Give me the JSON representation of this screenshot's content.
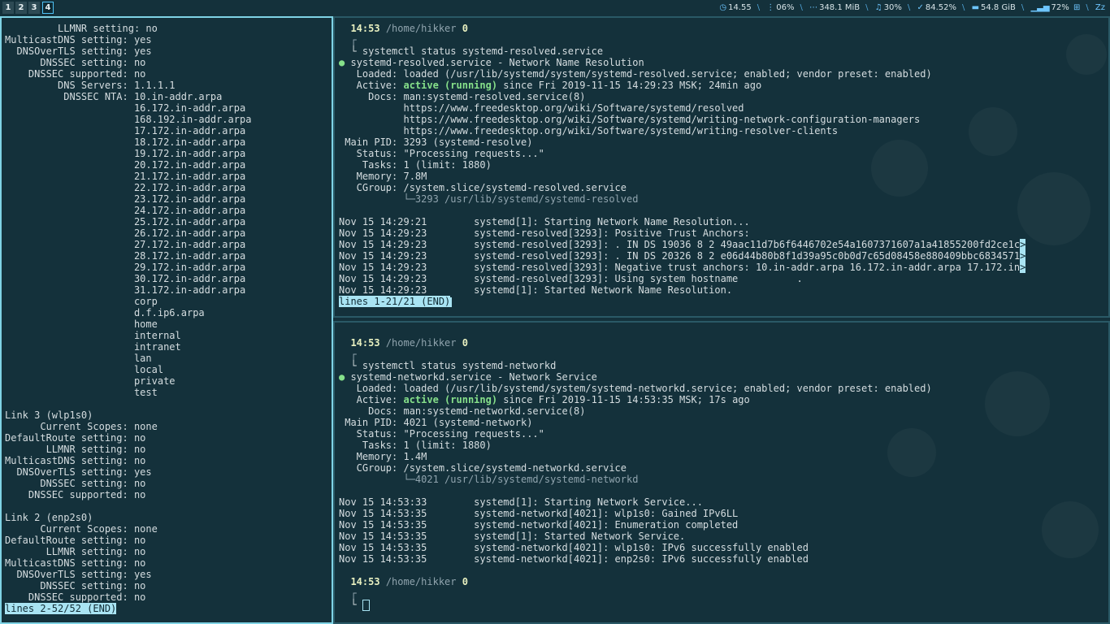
{
  "workspaces": [
    "1",
    "2",
    "3",
    "4"
  ],
  "active_workspace": "4",
  "status": {
    "clock": "14.55",
    "cpu": "06%",
    "memory": "348.1 MiB",
    "volume": "30%",
    "battery": "84.52%",
    "disk": "54.8 GiB",
    "wifi": "72%",
    "zz": "Zz"
  },
  "left": {
    "lines": [
      "         LLMNR setting: no",
      "MulticastDNS setting: yes",
      "  DNSOverTLS setting: yes",
      "      DNSSEC setting: no",
      "    DNSSEC supported: no",
      "         DNS Servers: 1.1.1.1",
      "          DNSSEC NTA: 10.in-addr.arpa",
      "                      16.172.in-addr.arpa",
      "                      168.192.in-addr.arpa",
      "                      17.172.in-addr.arpa",
      "                      18.172.in-addr.arpa",
      "                      19.172.in-addr.arpa",
      "                      20.172.in-addr.arpa",
      "                      21.172.in-addr.arpa",
      "                      22.172.in-addr.arpa",
      "                      23.172.in-addr.arpa",
      "                      24.172.in-addr.arpa",
      "                      25.172.in-addr.arpa",
      "                      26.172.in-addr.arpa",
      "                      27.172.in-addr.arpa",
      "                      28.172.in-addr.arpa",
      "                      29.172.in-addr.arpa",
      "                      30.172.in-addr.arpa",
      "                      31.172.in-addr.arpa",
      "                      corp",
      "                      d.f.ip6.arpa",
      "                      home",
      "                      internal",
      "                      intranet",
      "                      lan",
      "                      local",
      "                      private",
      "                      test",
      "",
      "Link 3 (wlp1s0)",
      "      Current Scopes: none",
      "DefaultRoute setting: no",
      "       LLMNR setting: no",
      "MulticastDNS setting: no",
      "  DNSOverTLS setting: yes",
      "      DNSSEC setting: no",
      "    DNSSEC supported: no",
      "",
      "Link 2 (enp2s0)",
      "      Current Scopes: none",
      "DefaultRoute setting: no",
      "       LLMNR setting: no",
      "MulticastDNS setting: no",
      "  DNSOverTLS setting: yes",
      "      DNSSEC setting: no",
      "    DNSSEC supported: no"
    ],
    "pager": "lines 2-52/52 (END)"
  },
  "top": {
    "prompt_time": "14:53",
    "prompt_path": "/home/hikker",
    "prompt_code": "0",
    "command": "systemctl status systemd-resolved.service",
    "unit": "systemd-resolved.service - Network Name Resolution",
    "loaded": "   Loaded: loaded (/usr/lib/systemd/system/systemd-resolved.service; enabled; vendor preset: enabled)",
    "active_label": "   Active: ",
    "active_state": "active (running)",
    "active_rest": " since Fri 2019-11-15 14:29:23 MSK; 24min ago",
    "details": [
      "     Docs: man:systemd-resolved.service(8)",
      "           https://www.freedesktop.org/wiki/Software/systemd/resolved",
      "           https://www.freedesktop.org/wiki/Software/systemd/writing-network-configuration-managers",
      "           https://www.freedesktop.org/wiki/Software/systemd/writing-resolver-clients",
      " Main PID: 3293 (systemd-resolve)",
      "   Status: \"Processing requests...\"",
      "    Tasks: 1 (limit: 1880)",
      "   Memory: 7.8M",
      "   CGroup: /system.slice/systemd-resolved.service"
    ],
    "tree": "           └─3293 /usr/lib/systemd/systemd-resolved",
    "logs": [
      {
        "text": "Nov 15 14:29:21        systemd[1]: Starting Network Name Resolution...",
        "trunc": false
      },
      {
        "text": "Nov 15 14:29:23        systemd-resolved[3293]: Positive Trust Anchors:",
        "trunc": false
      },
      {
        "text": "Nov 15 14:29:23        systemd-resolved[3293]: . IN DS 19036 8 2 49aac11d7b6f6446702e54a1607371607a1a41855200fd2ce1c",
        "trunc": true
      },
      {
        "text": "Nov 15 14:29:23        systemd-resolved[3293]: . IN DS 20326 8 2 e06d44b80b8f1d39a95c0b0d7c65d08458e880409bbc6834571",
        "trunc": true
      },
      {
        "text": "Nov 15 14:29:23        systemd-resolved[3293]: Negative trust anchors: 10.in-addr.arpa 16.172.in-addr.arpa 17.172.in",
        "trunc": true
      },
      {
        "text": "Nov 15 14:29:23        systemd-resolved[3293]: Using system hostname          .",
        "trunc": false
      },
      {
        "text": "Nov 15 14:29:23        systemd[1]: Started Network Name Resolution.",
        "trunc": false
      }
    ],
    "trunc_mark": ">",
    "pager": "lines 1-21/21 (END)"
  },
  "bottom": {
    "prompt_time": "14:53",
    "prompt_path": "/home/hikker",
    "prompt_code": "0",
    "command": "systemctl status systemd-networkd",
    "unit": "systemd-networkd.service - Network Service",
    "loaded": "   Loaded: loaded (/usr/lib/systemd/system/systemd-networkd.service; enabled; vendor preset: enabled)",
    "active_label": "   Active: ",
    "active_state": "active (running)",
    "active_rest": " since Fri 2019-11-15 14:53:35 MSK; 17s ago",
    "details": [
      "     Docs: man:systemd-networkd.service(8)",
      " Main PID: 4021 (systemd-network)",
      "   Status: \"Processing requests...\"",
      "    Tasks: 1 (limit: 1880)",
      "   Memory: 1.4M",
      "   CGroup: /system.slice/systemd-networkd.service"
    ],
    "tree": "           └─4021 /usr/lib/systemd/systemd-networkd",
    "logs": [
      "Nov 15 14:53:33        systemd[1]: Starting Network Service...",
      "Nov 15 14:53:35        systemd-networkd[4021]: wlp1s0: Gained IPv6LL",
      "Nov 15 14:53:35        systemd-networkd[4021]: Enumeration completed",
      "Nov 15 14:53:35        systemd[1]: Started Network Service.",
      "Nov 15 14:53:35        systemd-networkd[4021]: wlp1s0: IPv6 successfully enabled",
      "Nov 15 14:53:35        systemd-networkd[4021]: enp2s0: IPv6 successfully enabled"
    ],
    "prompt2_time": "14:53",
    "prompt2_path": "/home/hikker",
    "prompt2_code": "0"
  }
}
